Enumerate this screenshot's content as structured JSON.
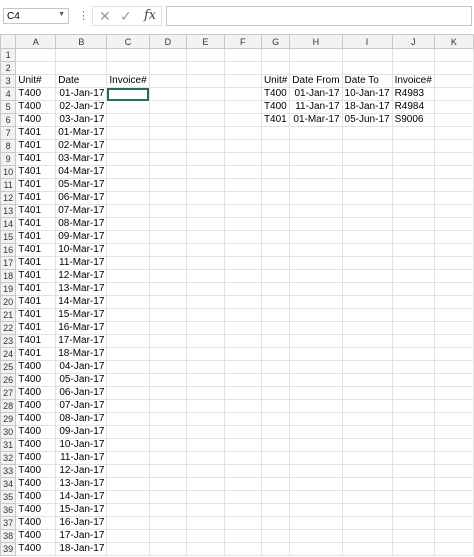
{
  "formula_bar": {
    "name_box": "C4",
    "fx_symbol": "fx",
    "formula": ""
  },
  "columns": [
    "A",
    "B",
    "C",
    "D",
    "E",
    "F",
    "G",
    "H",
    "I",
    "J",
    "K"
  ],
  "rows": [
    [
      "",
      "",
      "",
      "",
      "",
      "",
      "",
      "",
      "",
      "",
      ""
    ],
    [
      "",
      "",
      "",
      "",
      "",
      "",
      "",
      "",
      "",
      "",
      ""
    ],
    [
      "Unit#",
      "Date",
      "Invoice#",
      "",
      "",
      "",
      "Unit#",
      "Date From",
      "Date To",
      "Invoice#",
      ""
    ],
    [
      "T400",
      "01-Jan-17",
      "",
      "",
      "",
      "",
      "T400",
      "01-Jan-17",
      "10-Jan-17",
      "R4983",
      ""
    ],
    [
      "T400",
      "02-Jan-17",
      "",
      "",
      "",
      "",
      "T400",
      "11-Jan-17",
      "18-Jan-17",
      "R4984",
      ""
    ],
    [
      "T400",
      "03-Jan-17",
      "",
      "",
      "",
      "",
      "T401",
      "01-Mar-17",
      "05-Jun-17",
      "S9006",
      ""
    ],
    [
      "T401",
      "01-Mar-17",
      "",
      "",
      "",
      "",
      "",
      "",
      "",
      "",
      ""
    ],
    [
      "T401",
      "02-Mar-17",
      "",
      "",
      "",
      "",
      "",
      "",
      "",
      "",
      ""
    ],
    [
      "T401",
      "03-Mar-17",
      "",
      "",
      "",
      "",
      "",
      "",
      "",
      "",
      ""
    ],
    [
      "T401",
      "04-Mar-17",
      "",
      "",
      "",
      "",
      "",
      "",
      "",
      "",
      ""
    ],
    [
      "T401",
      "05-Mar-17",
      "",
      "",
      "",
      "",
      "",
      "",
      "",
      "",
      ""
    ],
    [
      "T401",
      "06-Mar-17",
      "",
      "",
      "",
      "",
      "",
      "",
      "",
      "",
      ""
    ],
    [
      "T401",
      "07-Mar-17",
      "",
      "",
      "",
      "",
      "",
      "",
      "",
      "",
      ""
    ],
    [
      "T401",
      "08-Mar-17",
      "",
      "",
      "",
      "",
      "",
      "",
      "",
      "",
      ""
    ],
    [
      "T401",
      "09-Mar-17",
      "",
      "",
      "",
      "",
      "",
      "",
      "",
      "",
      ""
    ],
    [
      "T401",
      "10-Mar-17",
      "",
      "",
      "",
      "",
      "",
      "",
      "",
      "",
      ""
    ],
    [
      "T401",
      "11-Mar-17",
      "",
      "",
      "",
      "",
      "",
      "",
      "",
      "",
      ""
    ],
    [
      "T401",
      "12-Mar-17",
      "",
      "",
      "",
      "",
      "",
      "",
      "",
      "",
      ""
    ],
    [
      "T401",
      "13-Mar-17",
      "",
      "",
      "",
      "",
      "",
      "",
      "",
      "",
      ""
    ],
    [
      "T401",
      "14-Mar-17",
      "",
      "",
      "",
      "",
      "",
      "",
      "",
      "",
      ""
    ],
    [
      "T401",
      "15-Mar-17",
      "",
      "",
      "",
      "",
      "",
      "",
      "",
      "",
      ""
    ],
    [
      "T401",
      "16-Mar-17",
      "",
      "",
      "",
      "",
      "",
      "",
      "",
      "",
      ""
    ],
    [
      "T401",
      "17-Mar-17",
      "",
      "",
      "",
      "",
      "",
      "",
      "",
      "",
      ""
    ],
    [
      "T401",
      "18-Mar-17",
      "",
      "",
      "",
      "",
      "",
      "",
      "",
      "",
      ""
    ],
    [
      "T400",
      "04-Jan-17",
      "",
      "",
      "",
      "",
      "",
      "",
      "",
      "",
      ""
    ],
    [
      "T400",
      "05-Jan-17",
      "",
      "",
      "",
      "",
      "",
      "",
      "",
      "",
      ""
    ],
    [
      "T400",
      "06-Jan-17",
      "",
      "",
      "",
      "",
      "",
      "",
      "",
      "",
      ""
    ],
    [
      "T400",
      "07-Jan-17",
      "",
      "",
      "",
      "",
      "",
      "",
      "",
      "",
      ""
    ],
    [
      "T400",
      "08-Jan-17",
      "",
      "",
      "",
      "",
      "",
      "",
      "",
      "",
      ""
    ],
    [
      "T400",
      "09-Jan-17",
      "",
      "",
      "",
      "",
      "",
      "",
      "",
      "",
      ""
    ],
    [
      "T400",
      "10-Jan-17",
      "",
      "",
      "",
      "",
      "",
      "",
      "",
      "",
      ""
    ],
    [
      "T400",
      "11-Jan-17",
      "",
      "",
      "",
      "",
      "",
      "",
      "",
      "",
      ""
    ],
    [
      "T400",
      "12-Jan-17",
      "",
      "",
      "",
      "",
      "",
      "",
      "",
      "",
      ""
    ],
    [
      "T400",
      "13-Jan-17",
      "",
      "",
      "",
      "",
      "",
      "",
      "",
      "",
      ""
    ],
    [
      "T400",
      "14-Jan-17",
      "",
      "",
      "",
      "",
      "",
      "",
      "",
      "",
      ""
    ],
    [
      "T400",
      "15-Jan-17",
      "",
      "",
      "",
      "",
      "",
      "",
      "",
      "",
      ""
    ],
    [
      "T400",
      "16-Jan-17",
      "",
      "",
      "",
      "",
      "",
      "",
      "",
      "",
      ""
    ],
    [
      "T400",
      "17-Jan-17",
      "",
      "",
      "",
      "",
      "",
      "",
      "",
      "",
      ""
    ],
    [
      "T400",
      "18-Jan-17",
      "",
      "",
      "",
      "",
      "",
      "",
      "",
      "",
      ""
    ]
  ],
  "selected_cell": "C4",
  "colors": {
    "header_bg": "#f2f2f2",
    "gridline": "#e2e2e2",
    "selection": "#217346"
  }
}
